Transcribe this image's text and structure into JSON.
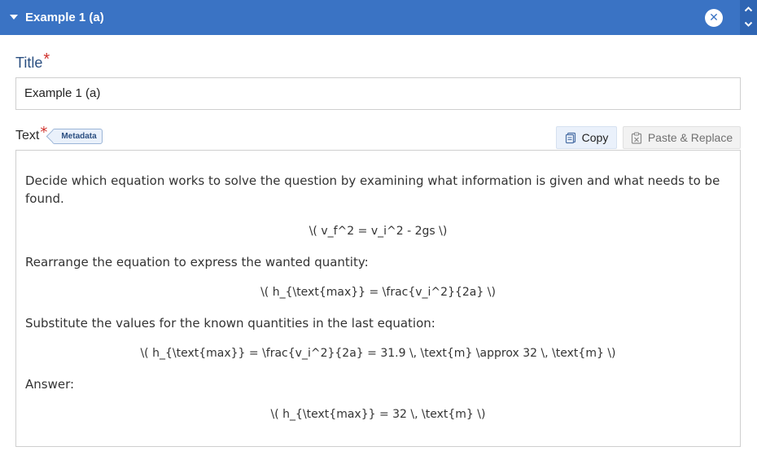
{
  "header": {
    "title": "Example 1 (a)"
  },
  "title_field": {
    "label": "Title",
    "required_mark": "*",
    "value": "Example 1 (a)"
  },
  "text_field": {
    "label": "Text",
    "required_mark": "*",
    "metadata_tag": "Metadata",
    "copy_label": "Copy",
    "paste_label": "Paste & Replace"
  },
  "content": {
    "intro": "Decide which equation works to solve the question by examining what information is given and what needs to be found.",
    "eq1": "\\( v_f^2 = v_i^2 - 2gs \\)",
    "step2": "Rearrange the equation to express the wanted quantity:",
    "eq2": "\\( h_{\\text{max}} = \\frac{v_i^2}{2a} \\)",
    "step3": "Substitute the values for the known quantities in the last equation:",
    "eq3": "\\( h_{\\text{max}} = \\frac{v_i^2}{2a} = 31.9 \\, \\text{m} \\approx 32 \\, \\text{m} \\)",
    "answer_label": "Answer:",
    "eq4": "\\( h_{\\text{max}} = 32 \\, \\text{m} \\)"
  },
  "colors": {
    "header_bg": "#3a73c4",
    "label_blue": "#2b4f81",
    "required_red": "#d0322d"
  }
}
